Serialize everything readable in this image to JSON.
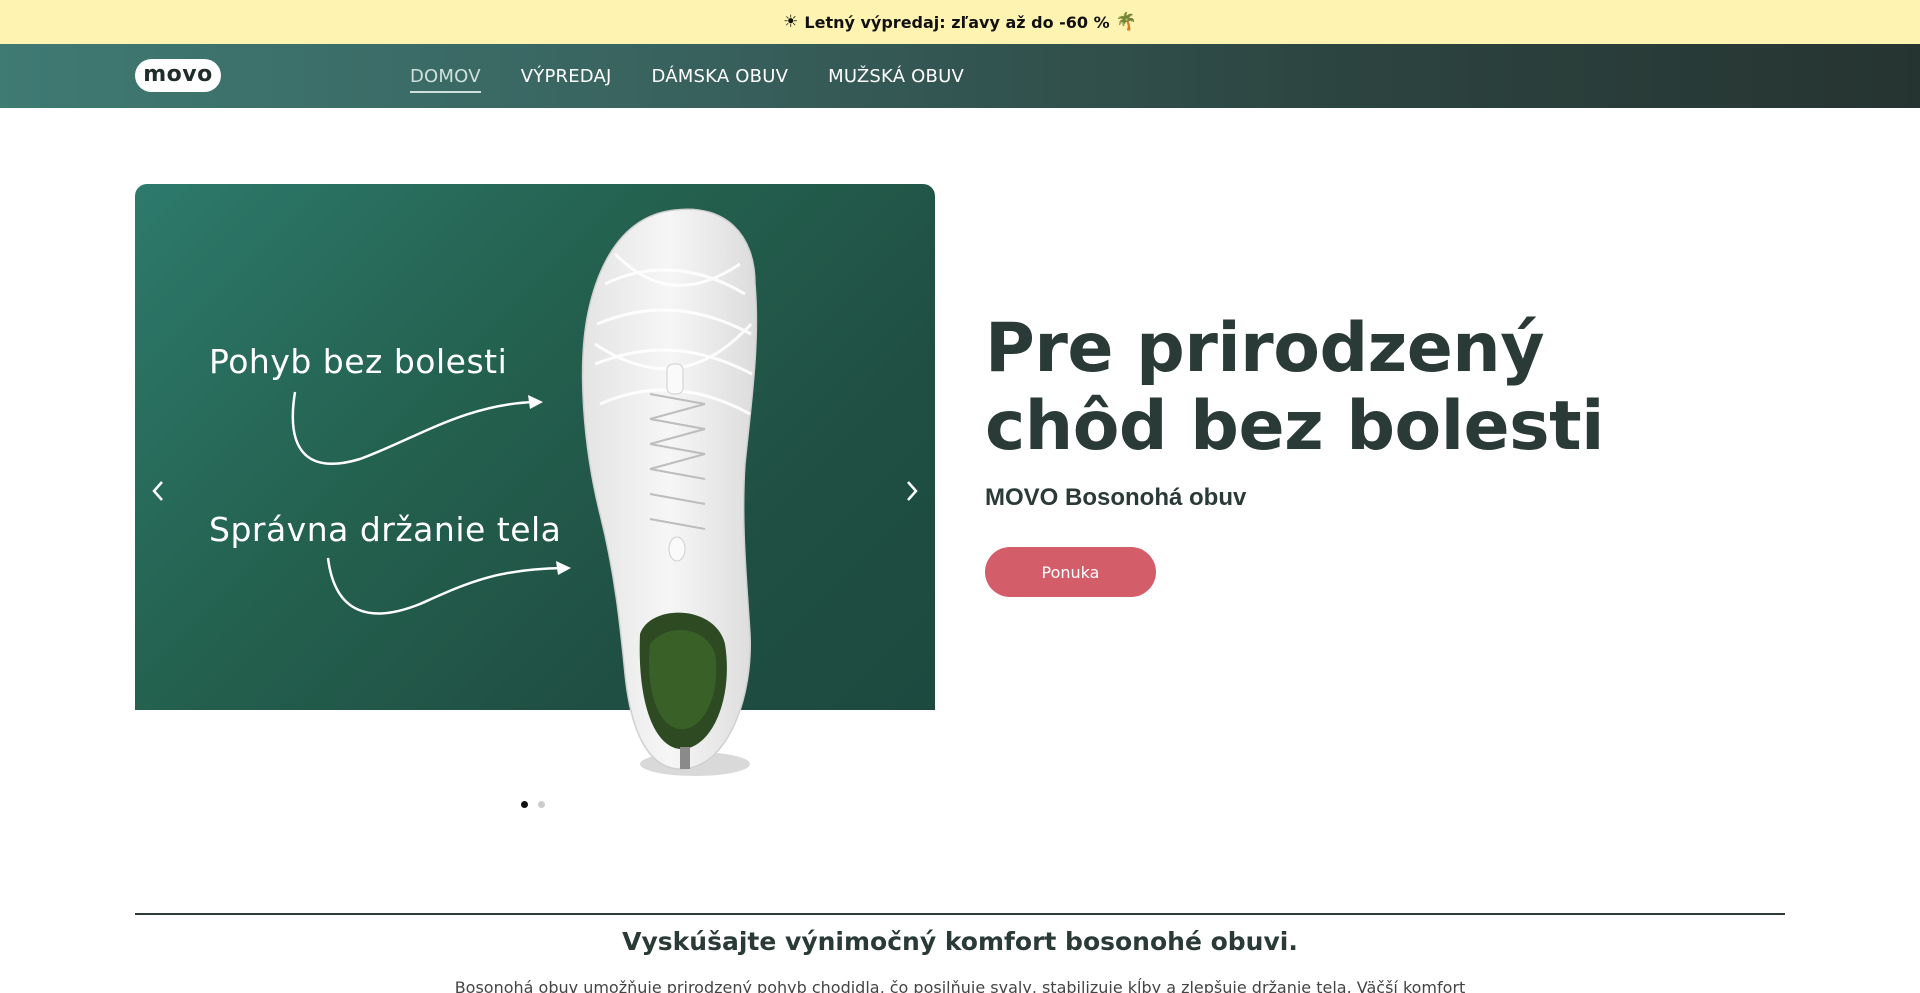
{
  "announcement": {
    "text": "Letný výpredaj: zľavy až do -60 %",
    "icon_left": "sun-icon",
    "icon_right": "palm-tree-icon"
  },
  "header": {
    "logo": "movo",
    "nav": [
      {
        "label": "DOMOV",
        "active": true
      },
      {
        "label": "VÝPREDAJ",
        "active": false
      },
      {
        "label": "DÁMSKA OBUV",
        "active": false
      },
      {
        "label": "MUŽSKÁ OBUV",
        "active": false
      }
    ]
  },
  "slider": {
    "slide_text_1": "Pohyb bez bolesti",
    "slide_text_2": "Správna držanie tela",
    "prev_icon": "chevron-left-icon",
    "next_icon": "chevron-right-icon",
    "slide_count": 2,
    "active_slide": 1
  },
  "hero": {
    "title": "Pre prirodzený chôd bez bolesti",
    "subtitle": "MOVO Bosonohá obuv",
    "cta_label": "Ponuka"
  },
  "section": {
    "title": "Vyskúšajte výnimočný komfort bosonohé obuvi.",
    "text": "Bosonohá obuv umožňuje prirodzený pohyb chodidla, čo posilňuje svaly, stabilizuje kĺby a zlepšuje držanie tela. Väčší komfort"
  },
  "colors": {
    "announcement_bg": "#fef3b0",
    "header_start": "#3f7a73",
    "header_end": "#263431",
    "slide_bg": "#24614f",
    "cta": "#d45d6a",
    "text_dark": "#2a3a37"
  }
}
